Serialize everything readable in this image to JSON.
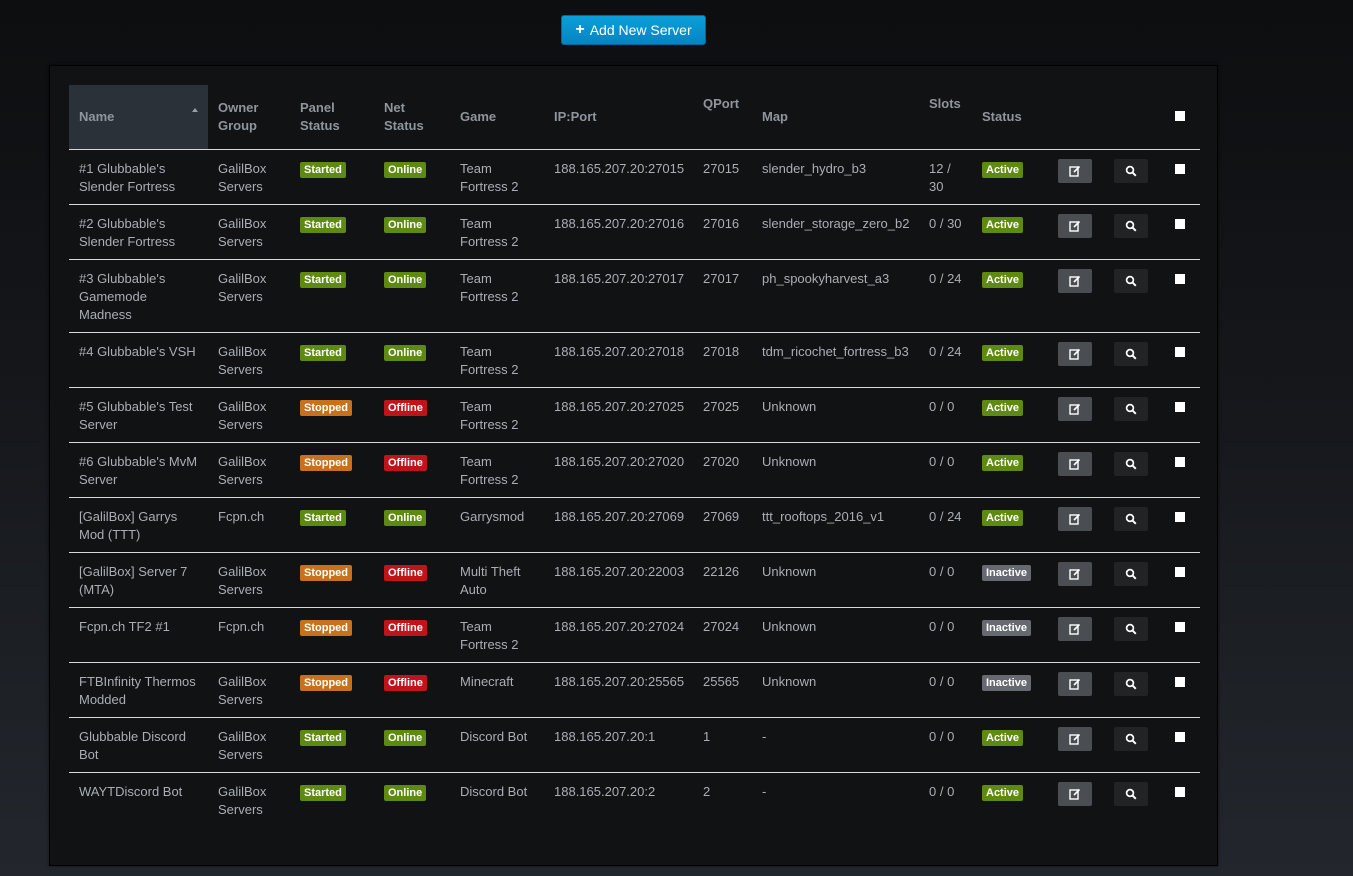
{
  "toolbar": {
    "add_label": "Add New Server",
    "add_icon": "plus-icon"
  },
  "table": {
    "headers": {
      "name": "Name",
      "owner_group": "Owner Group",
      "panel_status": "Panel Status",
      "net_status": "Net Status",
      "game": "Game",
      "ip_port": "IP:Port",
      "qport": "QPort",
      "map": "Map",
      "slots": "Slots",
      "status": "Status"
    },
    "sorted_by": "Name",
    "sort_direction": "ascending",
    "colors": {
      "started": "#5e8a11",
      "online": "#5e8a11",
      "active": "#5e8a11",
      "stopped": "#c8711c",
      "offline": "#c0141b",
      "inactive": "#666a70"
    },
    "rows": [
      {
        "name": "#1 Glubbable's Slender Fortress",
        "owner": "GalilBox Servers",
        "panel": "Started",
        "net": "Online",
        "game": "Team Fortress 2",
        "ip": "188.165.207.20:27015",
        "qport": "27015",
        "map": "slender_hydro_b3",
        "slots": "12 / 30",
        "status": "Active"
      },
      {
        "name": "#2 Glubbable's Slender Fortress",
        "owner": "GalilBox Servers",
        "panel": "Started",
        "net": "Online",
        "game": "Team Fortress 2",
        "ip": "188.165.207.20:27016",
        "qport": "27016",
        "map": "slender_storage_zero_b2",
        "slots": "0 / 30",
        "status": "Active"
      },
      {
        "name": "#3 Glubbable's Gamemode Madness",
        "owner": "GalilBox Servers",
        "panel": "Started",
        "net": "Online",
        "game": "Team Fortress 2",
        "ip": "188.165.207.20:27017",
        "qport": "27017",
        "map": "ph_spookyharvest_a3",
        "slots": "0 / 24",
        "status": "Active"
      },
      {
        "name": "#4 Glubbable's VSH",
        "owner": "GalilBox Servers",
        "panel": "Started",
        "net": "Online",
        "game": "Team Fortress 2",
        "ip": "188.165.207.20:27018",
        "qport": "27018",
        "map": "tdm_ricochet_fortress_b3",
        "slots": "0 / 24",
        "status": "Active"
      },
      {
        "name": "#5 Glubbable's Test Server",
        "owner": "GalilBox Servers",
        "panel": "Stopped",
        "net": "Offline",
        "game": "Team Fortress 2",
        "ip": "188.165.207.20:27025",
        "qport": "27025",
        "map": "Unknown",
        "slots": "0 / 0",
        "status": "Active"
      },
      {
        "name": "#6 Glubbable's MvM Server",
        "owner": "GalilBox Servers",
        "panel": "Stopped",
        "net": "Offline",
        "game": "Team Fortress 2",
        "ip": "188.165.207.20:27020",
        "qport": "27020",
        "map": "Unknown",
        "slots": "0 / 0",
        "status": "Active"
      },
      {
        "name": "[GalilBox] Garrys Mod (TTT)",
        "owner": "Fcpn.ch",
        "panel": "Started",
        "net": "Online",
        "game": "Garrysmod",
        "ip": "188.165.207.20:27069",
        "qport": "27069",
        "map": "ttt_rooftops_2016_v1",
        "slots": "0 / 24",
        "status": "Active"
      },
      {
        "name": "[GalilBox] Server 7 (MTA)",
        "owner": "GalilBox Servers",
        "panel": "Stopped",
        "net": "Offline",
        "game": "Multi Theft Auto",
        "ip": "188.165.207.20:22003",
        "qport": "22126",
        "map": "Unknown",
        "slots": "0 / 0",
        "status": "Inactive"
      },
      {
        "name": "Fcpn.ch TF2 #1",
        "owner": "Fcpn.ch",
        "panel": "Stopped",
        "net": "Offline",
        "game": "Team Fortress 2",
        "ip": "188.165.207.20:27024",
        "qport": "27024",
        "map": "Unknown",
        "slots": "0 / 0",
        "status": "Inactive"
      },
      {
        "name": "FTBInfinity Thermos Modded",
        "owner": "GalilBox Servers",
        "panel": "Stopped",
        "net": "Offline",
        "game": "Minecraft",
        "ip": "188.165.207.20:25565",
        "qport": "25565",
        "map": "Unknown",
        "slots": "0 / 0",
        "status": "Inactive"
      },
      {
        "name": "Glubbable Discord Bot",
        "owner": "GalilBox Servers",
        "panel": "Started",
        "net": "Online",
        "game": "Discord Bot",
        "ip": "188.165.207.20:1",
        "qport": "1",
        "map": "-",
        "slots": "0 / 0",
        "status": "Active"
      },
      {
        "name": "WAYTDiscord Bot",
        "owner": "GalilBox Servers",
        "panel": "Started",
        "net": "Online",
        "game": "Discord Bot",
        "ip": "188.165.207.20:2",
        "qport": "2",
        "map": "-",
        "slots": "0 / 0",
        "status": "Active"
      }
    ]
  }
}
